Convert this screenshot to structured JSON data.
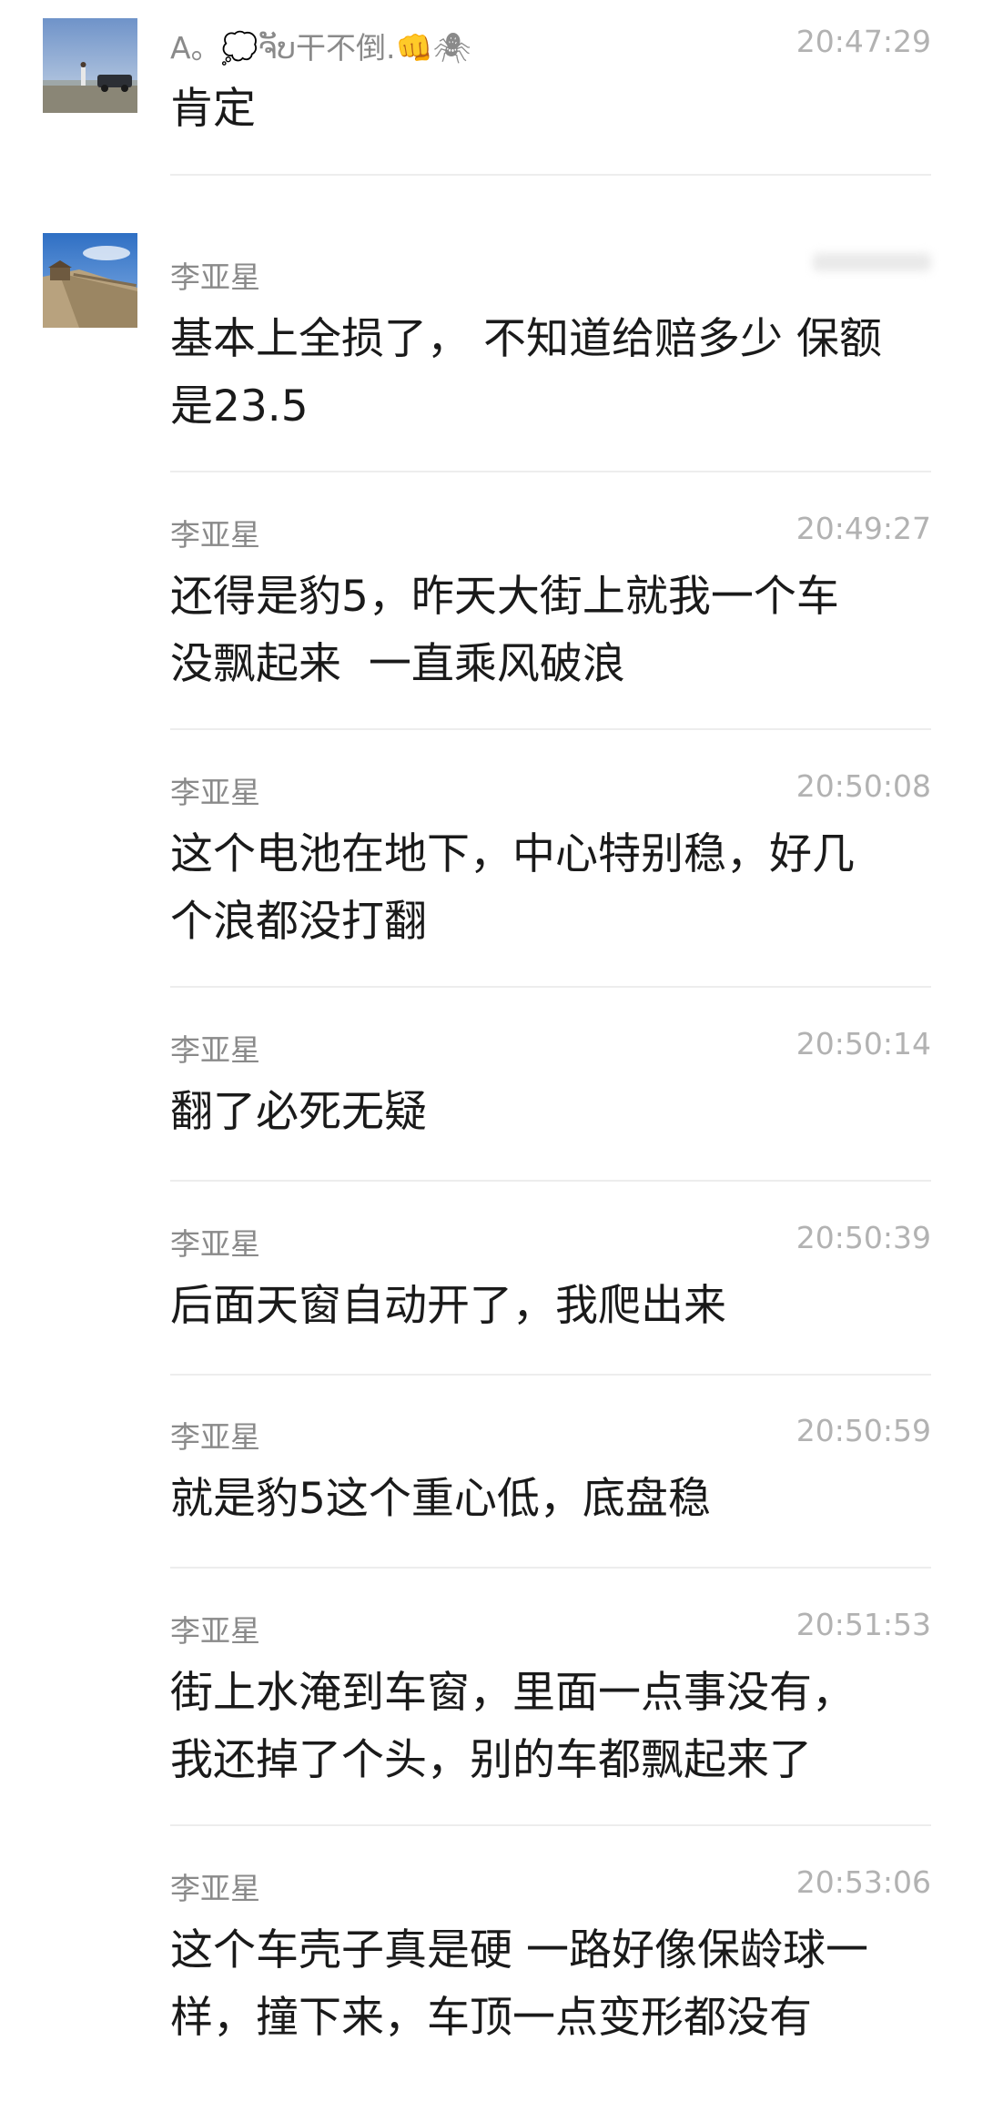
{
  "messages": [
    {
      "sender": "A。💭ຈັບ干不倒.👊🕷",
      "time": "20:47:29",
      "text": "肯定",
      "avatar": "avatar-1"
    },
    {
      "sender": "李亚星",
      "time": "",
      "text": "基本上全损了， 不知道给赔多少 保额\n是23.5",
      "avatar": "avatar-2",
      "time_blurred": true
    },
    {
      "sender": "李亚星",
      "time": "20:49:27",
      "text": "还得是豹5，昨天大街上就我一个车\n没飘起来  一直乘风破浪",
      "avatar": ""
    },
    {
      "sender": "李亚星",
      "time": "20:50:08",
      "text": "这个电池在地下，中心特别稳，好几\n个浪都没打翻",
      "avatar": ""
    },
    {
      "sender": "李亚星",
      "time": "20:50:14",
      "text": "翻了必死无疑",
      "avatar": ""
    },
    {
      "sender": "李亚星",
      "time": "20:50:39",
      "text": "后面天窗自动开了，我爬出来",
      "avatar": ""
    },
    {
      "sender": "李亚星",
      "time": "20:50:59",
      "text": "就是豹5这个重心低，底盘稳",
      "avatar": ""
    },
    {
      "sender": "李亚星",
      "time": "20:51:53",
      "text": "街上水淹到车窗，里面一点事没有，\n我还掉了个头，别的车都飘起来了",
      "avatar": ""
    },
    {
      "sender": "李亚星",
      "time": "20:53:06",
      "text": "这个车壳子真是硬 一路好像保龄球一\n样，撞下来，车顶一点变形都没有",
      "avatar": ""
    }
  ],
  "colors": {
    "name": "#8a8a8a",
    "time": "#b2b2b2",
    "text": "#1a1a1a",
    "divider": "#ededed"
  }
}
